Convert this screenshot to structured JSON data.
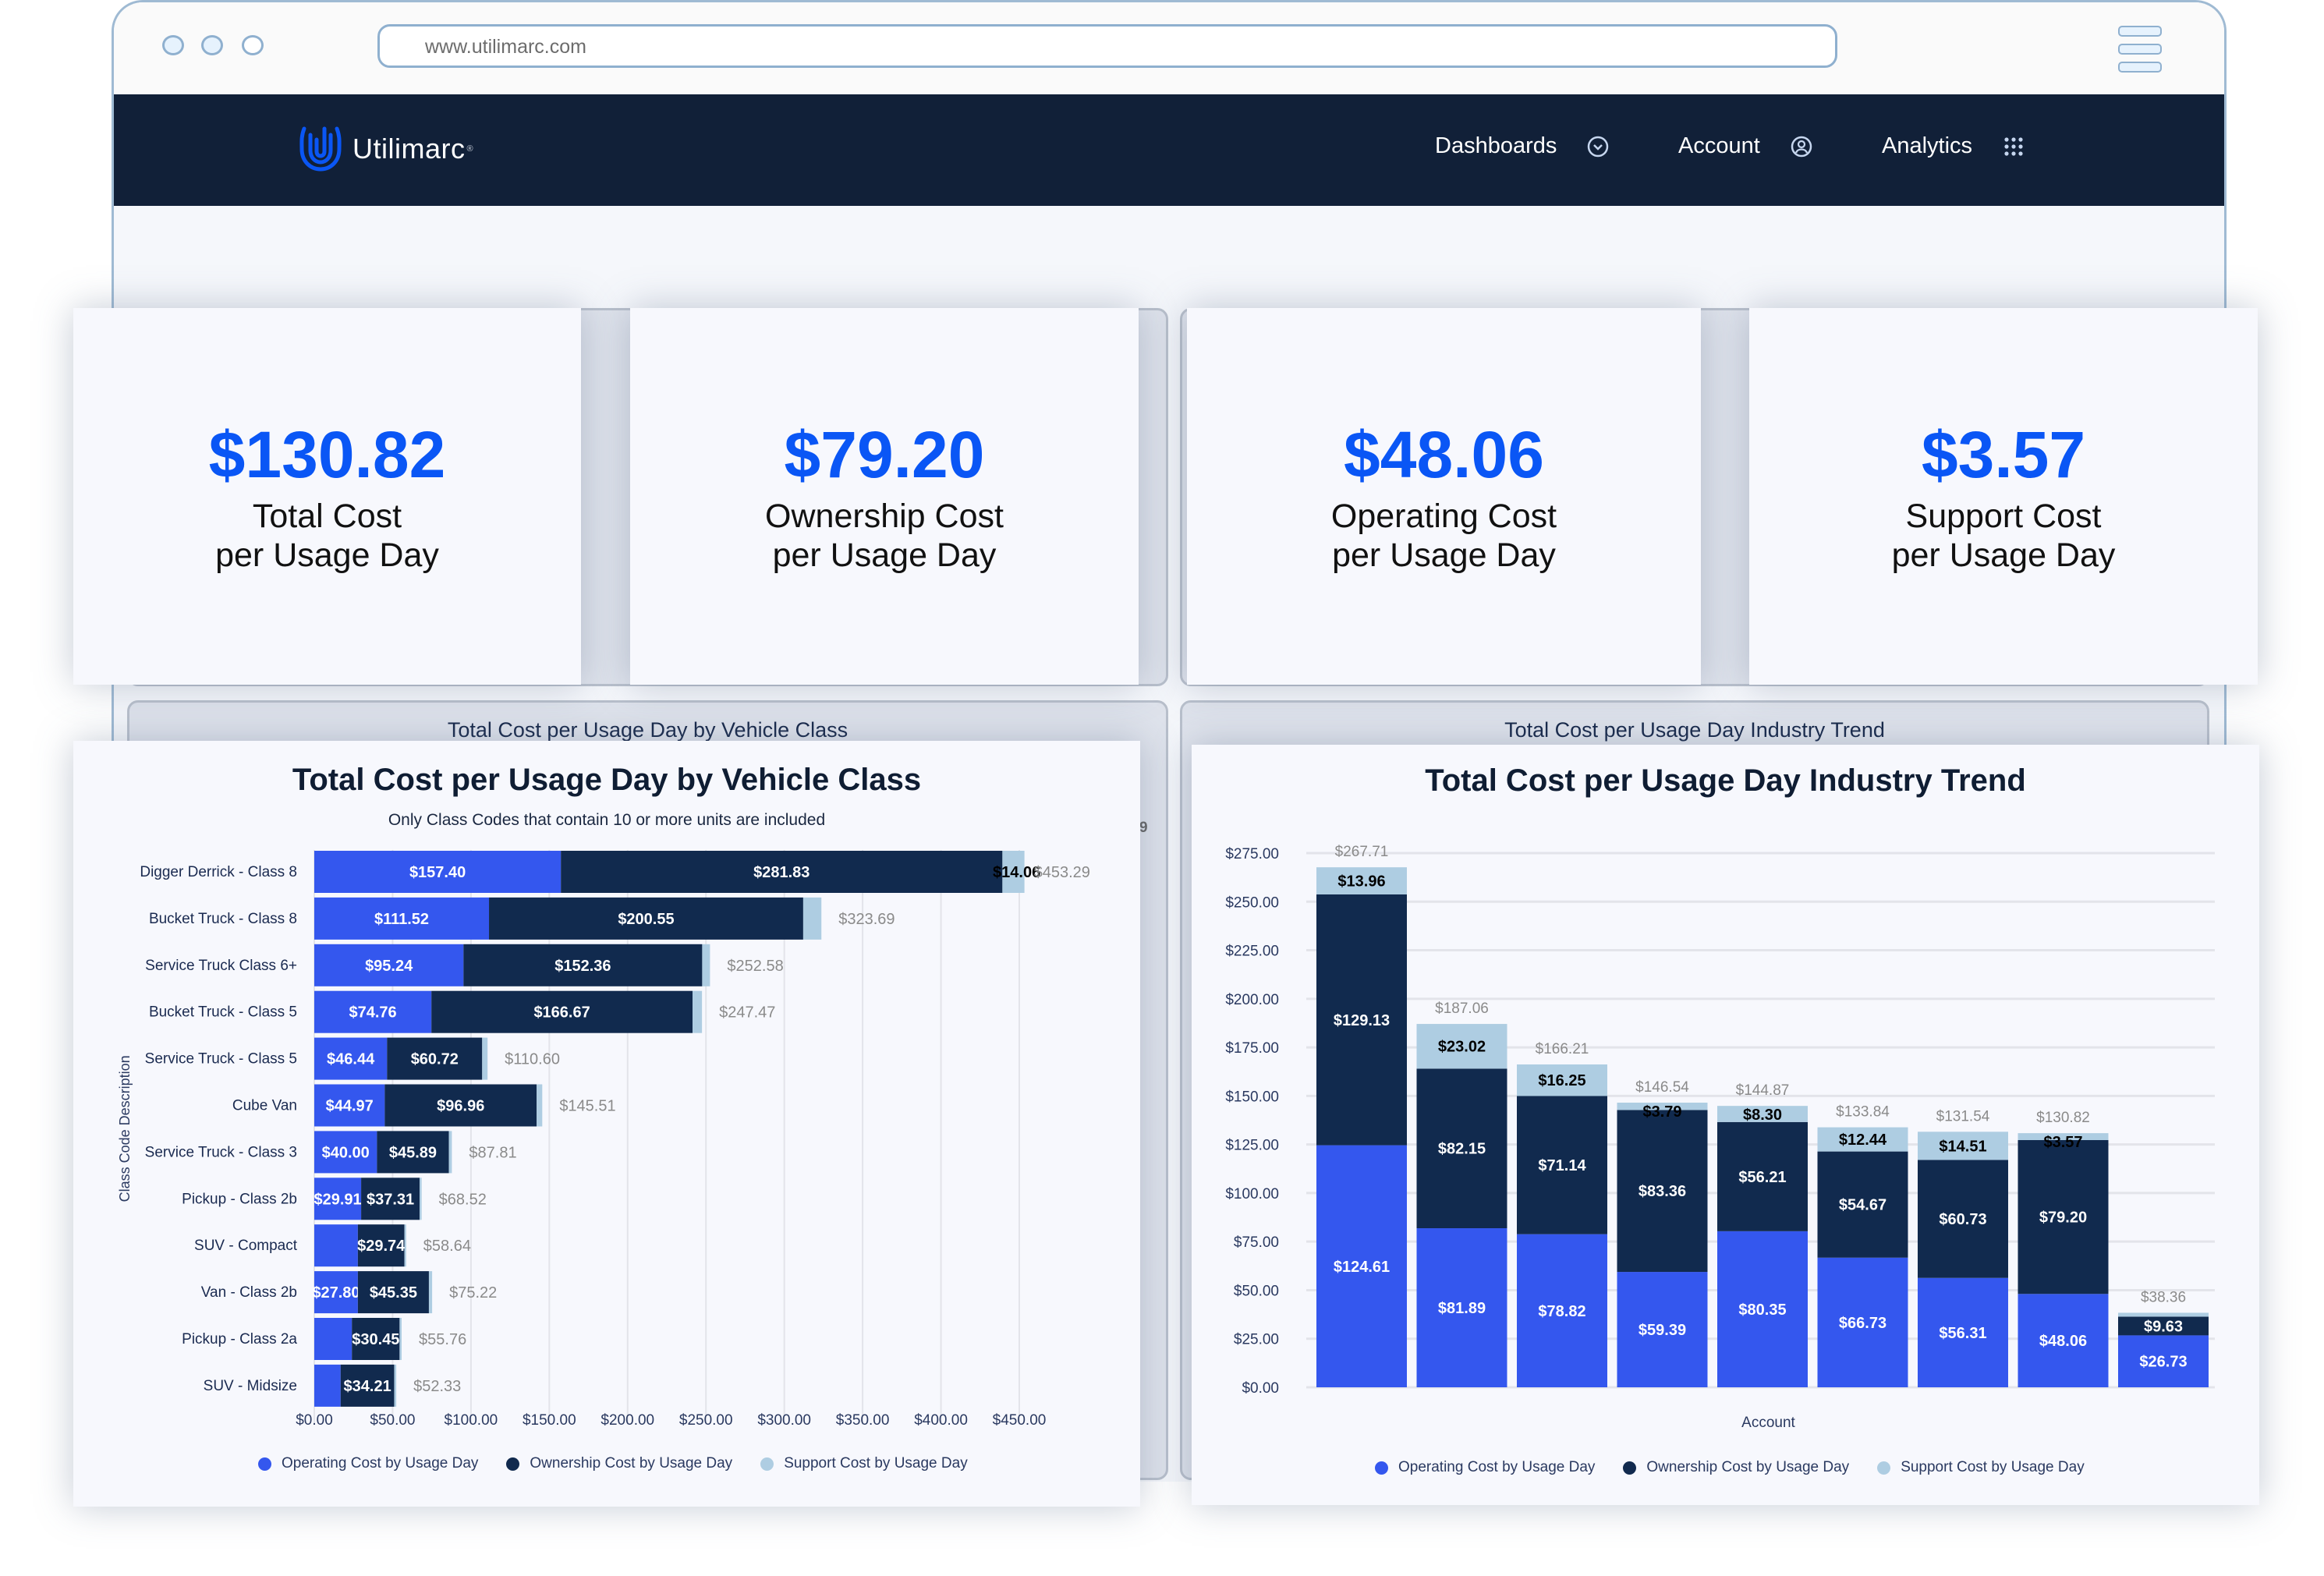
{
  "browser": {
    "url": "www.utilimarc.com"
  },
  "navbar": {
    "brand": "Utilimarc",
    "brand_mark": "®",
    "items": [
      {
        "label": "Dashboards",
        "icon": "chevron-circle-down-icon"
      },
      {
        "label": "Account",
        "icon": "user-circle-icon"
      },
      {
        "label": "Analytics",
        "icon": "grid-dots-icon"
      }
    ]
  },
  "colors": {
    "navbar_bg": "#112038",
    "accent": "#0a56f5",
    "operating": "#3457ee",
    "ownership": "#112a4e",
    "support": "#aecde2"
  },
  "kpis": [
    {
      "value": "$130.82",
      "label_line1": "Total Cost",
      "label_line2": "per Usage Day"
    },
    {
      "value": "$79.20",
      "label_line1": "Ownership Cost",
      "label_line2": "per Usage Day"
    },
    {
      "value": "$48.06",
      "label_line1": "Operating Cost",
      "label_line2": "per Usage Day"
    },
    {
      "value": "$3.57",
      "label_line1": "Support Cost",
      "label_line2": "per Usage Day"
    }
  ],
  "background_panels": {
    "left_title": "Total Cost per Usage Day by Vehicle Class",
    "right_title": "Total Cost per Usage Day Industry Trend",
    "stray_text": "9"
  },
  "chart_data": [
    {
      "type": "bar",
      "orientation": "horizontal",
      "stacked": true,
      "title": "Total Cost per Usage Day by Vehicle Class",
      "subtitle": "Only Class Codes that contain 10 or more units are included",
      "xlabel": "",
      "ylabel": "Class Code Description",
      "xlim": [
        0,
        450
      ],
      "xticks": [
        "$0.00",
        "$50.00",
        "$100.00",
        "$150.00",
        "$200.00",
        "$250.00",
        "$300.00",
        "$350.00",
        "$400.00",
        "$450.00"
      ],
      "grid": true,
      "legend_position": "bottom",
      "categories": [
        "Digger Derrick - Class 8",
        "Bucket Truck - Class 8",
        "Service Truck Class 6+",
        "Bucket Truck - Class 5",
        "Service Truck - Class 5",
        "Cube Van",
        "Service Truck - Class 3",
        "Pickup - Class 2b",
        "SUV - Compact",
        "Van - Class 2b",
        "Pickup - Class 2a",
        "SUV - Midsize"
      ],
      "series": [
        {
          "name": "Operating Cost by Usage Day",
          "values": [
            157.4,
            111.52,
            95.24,
            74.76,
            46.44,
            44.97,
            40.0,
            29.91,
            27.8,
            27.8,
            24.0,
            16.8
          ],
          "labels": [
            "$157.40",
            "$111.52",
            "$95.24",
            "$74.76",
            "$46.44",
            "$44.97",
            "$40.00",
            "$29.91",
            "",
            "$27.80",
            "",
            ""
          ]
        },
        {
          "name": "Ownership Cost by Usage Day",
          "values": [
            281.83,
            200.55,
            152.36,
            166.67,
            60.72,
            96.96,
            45.89,
            37.31,
            29.74,
            45.35,
            30.45,
            34.21
          ],
          "labels": [
            "$281.83",
            "$200.55",
            "$152.36",
            "$166.67",
            "$60.72",
            "$96.96",
            "$45.89",
            "$37.31",
            "$29.74",
            "$45.35",
            "$30.45",
            "$34.21"
          ]
        },
        {
          "name": "Support Cost by Usage Day",
          "values": [
            14.06,
            11.62,
            4.98,
            6.04,
            3.44,
            3.58,
            1.92,
            1.3,
            1.1,
            2.07,
            1.31,
            1.32
          ],
          "labels": [
            "$14.06",
            "",
            "",
            "",
            "",
            "",
            "",
            "",
            "",
            "",
            "",
            ""
          ]
        }
      ],
      "totals": [
        "$453.29",
        "$323.69",
        "$252.58",
        "$247.47",
        "$110.60",
        "$145.51",
        "$87.81",
        "$68.52",
        "$58.64",
        "$75.22",
        "$55.76",
        "$52.33"
      ]
    },
    {
      "type": "bar",
      "orientation": "vertical",
      "stacked": true,
      "title": "Total Cost per Usage Day Industry Trend",
      "xlabel": "Account",
      "ylabel": "",
      "ylim": [
        0,
        275
      ],
      "yticks": [
        "$0.00",
        "$25.00",
        "$50.00",
        "$75.00",
        "$100.00",
        "$125.00",
        "$150.00",
        "$175.00",
        "$200.00",
        "$225.00",
        "$250.00",
        "$275.00"
      ],
      "grid": true,
      "legend_position": "bottom",
      "categories": [
        "",
        "",
        "",
        "",
        "",
        "",
        "",
        "",
        ""
      ],
      "series": [
        {
          "name": "Operating Cost by Usage Day",
          "values": [
            124.61,
            81.89,
            78.82,
            59.39,
            80.35,
            66.73,
            56.31,
            48.06,
            26.73
          ],
          "labels": [
            "$124.61",
            "$81.89",
            "$78.82",
            "$59.39",
            "$80.35",
            "$66.73",
            "$56.31",
            "$48.06",
            "$26.73"
          ]
        },
        {
          "name": "Ownership Cost by Usage Day",
          "values": [
            129.13,
            82.15,
            71.14,
            83.36,
            56.21,
            54.67,
            60.73,
            79.2,
            9.63
          ],
          "labels": [
            "$129.13",
            "$82.15",
            "$71.14",
            "$83.36",
            "$56.21",
            "$54.67",
            "$60.73",
            "$79.20",
            "$9.63"
          ]
        },
        {
          "name": "Support Cost by Usage Day",
          "values": [
            13.96,
            23.02,
            16.25,
            3.79,
            8.3,
            12.44,
            14.51,
            3.57,
            2.0
          ],
          "labels": [
            "$13.96",
            "$23.02",
            "$16.25",
            "$3.79",
            "$8.30",
            "$12.44",
            "$14.51",
            "$3.57",
            ""
          ]
        }
      ],
      "totals": [
        "$267.71",
        "$187.06",
        "$166.21",
        "$146.54",
        "$144.87",
        "$133.84",
        "$131.54",
        "$130.82",
        "$38.36"
      ]
    }
  ]
}
